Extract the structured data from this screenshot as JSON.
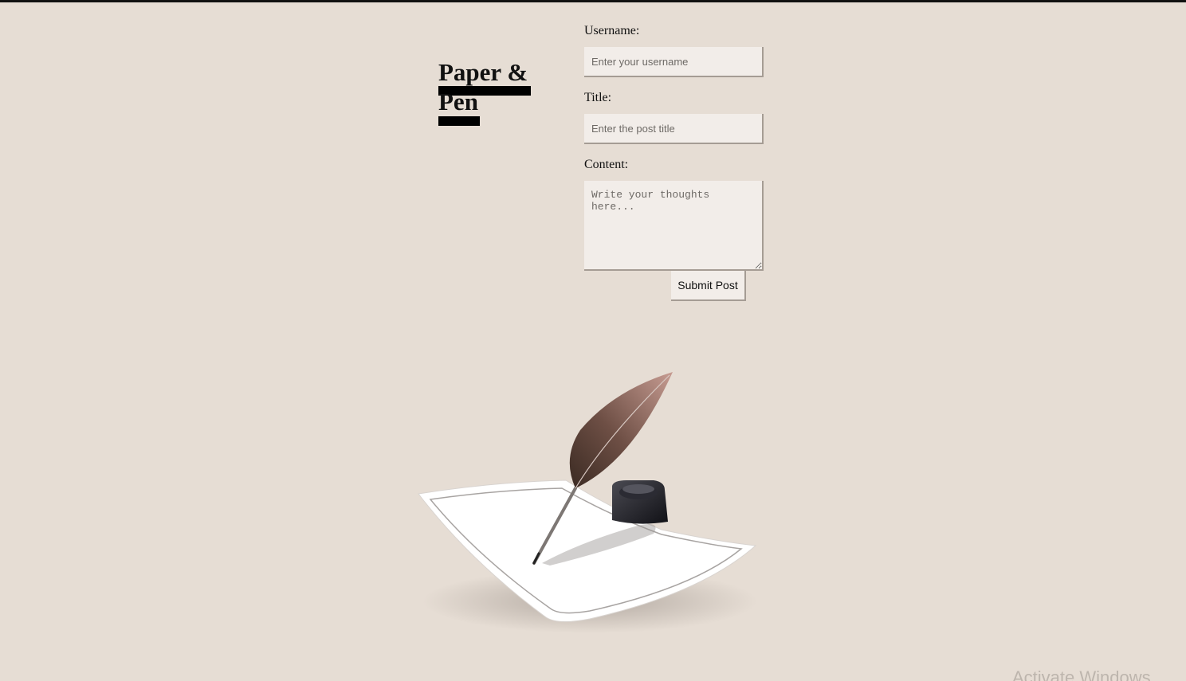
{
  "brand": {
    "line1": "Paper &",
    "line2": "Pen"
  },
  "form": {
    "username_label": "Username:",
    "username_placeholder": "Enter your username",
    "title_label": "Title:",
    "title_placeholder": "Enter the post title",
    "content_label": "Content:",
    "content_placeholder": "Write your thoughts here...",
    "submit_label": "Submit Post"
  },
  "illustration": {
    "icon": "quill-paper-inkwell-icon"
  },
  "system": {
    "watermark": "Activate Windows"
  },
  "colors": {
    "background": "#e6ddd4",
    "field_background": "#f2ede9",
    "field_border": "#a59c94"
  }
}
